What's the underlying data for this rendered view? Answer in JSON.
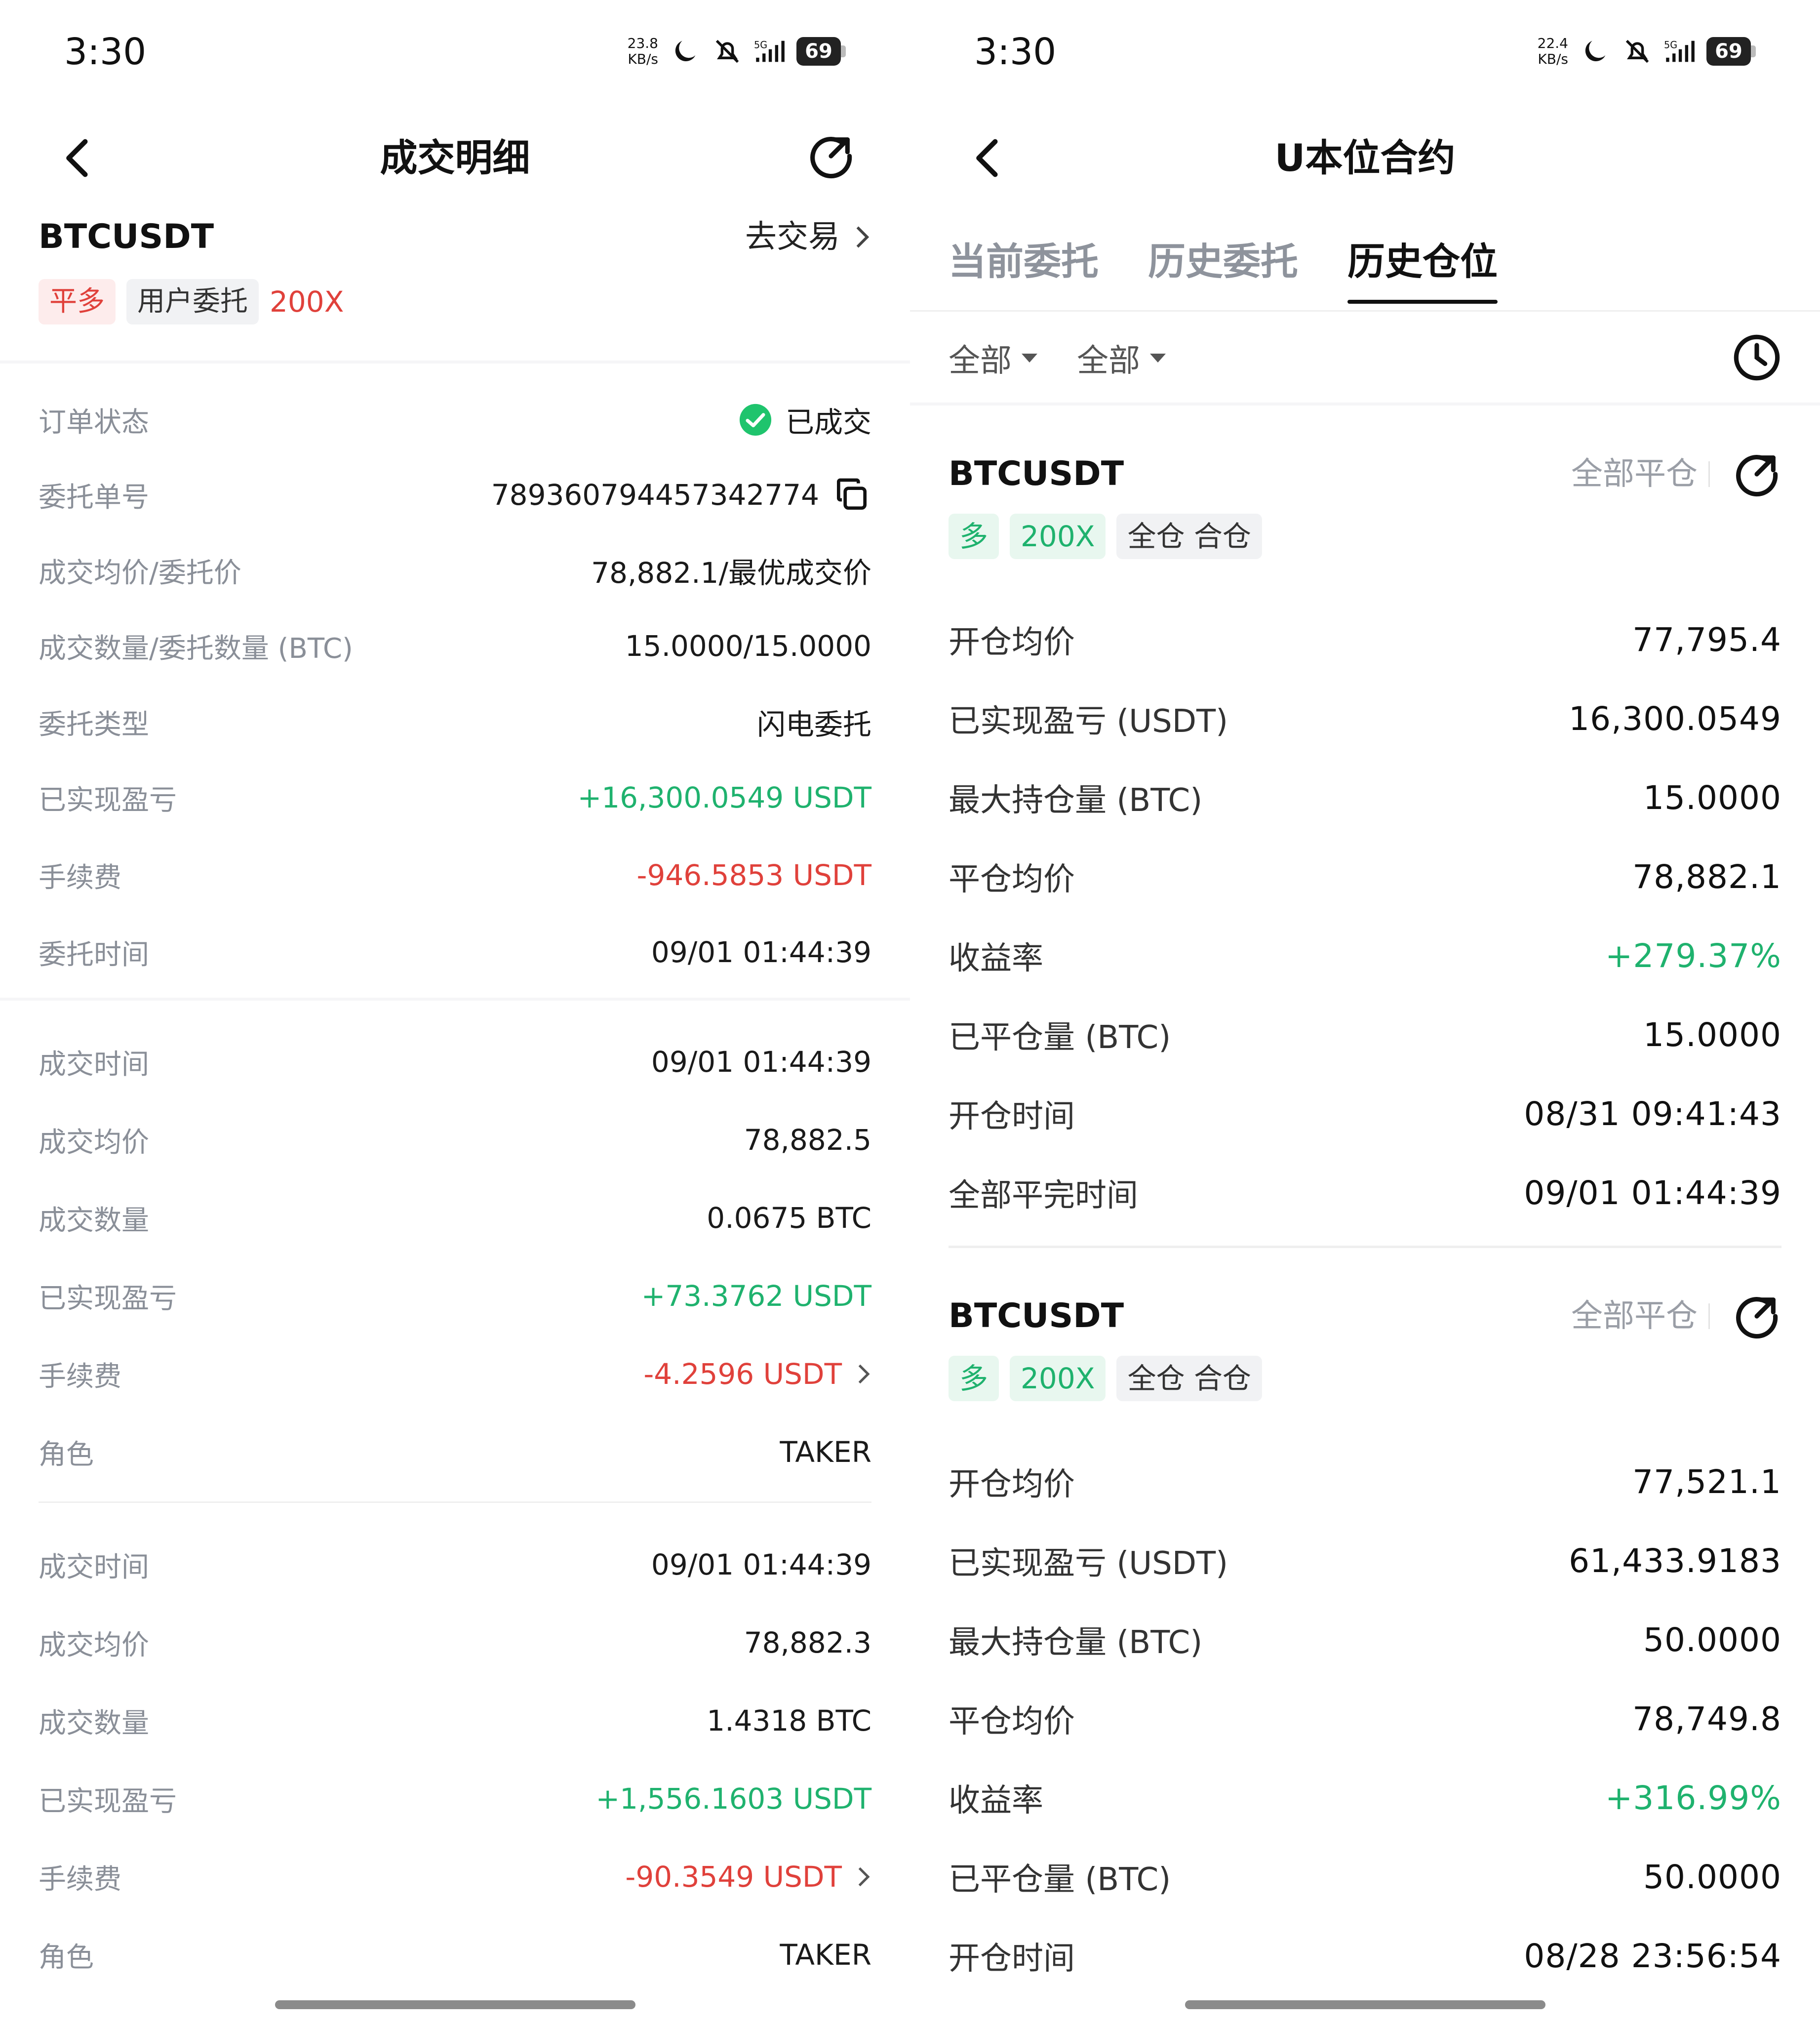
{
  "left": {
    "status": {
      "time": "3:30",
      "speed": "23.8",
      "speed_unit": "KB/s",
      "net": "5G",
      "battery": "69"
    },
    "title": "成交明细",
    "symbol": "BTCUSDT",
    "goto_trade": "去交易",
    "tags": {
      "side": "平多",
      "source": "用户委托",
      "leverage": "200X"
    },
    "details": [
      {
        "k": "订单状态",
        "v": "已成交"
      },
      {
        "k": "委托单号",
        "v": "789360794457342774"
      },
      {
        "k": "成交均价/委托价",
        "v": "78,882.1/最优成交价"
      },
      {
        "k": "成交数量/委托数量 (BTC)",
        "v": "15.0000/15.0000"
      },
      {
        "k": "委托类型",
        "v": "闪电委托"
      },
      {
        "k": "已实现盈亏",
        "v": "+16,300.0549 USDT"
      },
      {
        "k": "手续费",
        "v": "-946.5853 USDT"
      },
      {
        "k": "委托时间",
        "v": "09/01 01:44:39"
      }
    ],
    "fills": [
      [
        {
          "k": "成交时间",
          "v": "09/01 01:44:39"
        },
        {
          "k": "成交均价",
          "v": "78,882.5"
        },
        {
          "k": "成交数量",
          "v": "0.0675 BTC"
        },
        {
          "k": "已实现盈亏",
          "v": "+73.3762 USDT"
        },
        {
          "k": "手续费",
          "v": "-4.2596 USDT"
        },
        {
          "k": "角色",
          "v": "TAKER"
        }
      ],
      [
        {
          "k": "成交时间",
          "v": "09/01 01:44:39"
        },
        {
          "k": "成交均价",
          "v": "78,882.3"
        },
        {
          "k": "成交数量",
          "v": "1.4318 BTC"
        },
        {
          "k": "已实现盈亏",
          "v": "+1,556.1603 USDT"
        },
        {
          "k": "手续费",
          "v": "-90.3549 USDT"
        },
        {
          "k": "角色",
          "v": "TAKER"
        }
      ]
    ]
  },
  "right": {
    "status": {
      "time": "3:30",
      "speed": "22.4",
      "speed_unit": "KB/s",
      "net": "5G",
      "battery": "69"
    },
    "title": "U本位合约",
    "tabs": [
      "当前委托",
      "历史委托",
      "历史仓位"
    ],
    "filters": [
      "全部",
      "全部"
    ],
    "positions": [
      {
        "symbol": "BTCUSDT",
        "close_all": "全部平仓",
        "tags": {
          "side": "多",
          "leverage": "200X",
          "mode": "全仓 合仓"
        },
        "rows": [
          {
            "k": "开仓均价",
            "v": "77,795.4"
          },
          {
            "k": "已实现盈亏 (USDT)",
            "v": "16,300.0549"
          },
          {
            "k": "最大持仓量 (BTC)",
            "v": "15.0000"
          },
          {
            "k": "平仓均价",
            "v": "78,882.1"
          },
          {
            "k": "收益率",
            "v": "+279.37%"
          },
          {
            "k": "已平仓量 (BTC)",
            "v": "15.0000"
          },
          {
            "k": "开仓时间",
            "v": "08/31 09:41:43"
          },
          {
            "k": "全部平完时间",
            "v": "09/01 01:44:39"
          }
        ]
      },
      {
        "symbol": "BTCUSDT",
        "close_all": "全部平仓",
        "tags": {
          "side": "多",
          "leverage": "200X",
          "mode": "全仓 合仓"
        },
        "rows": [
          {
            "k": "开仓均价",
            "v": "77,521.1"
          },
          {
            "k": "已实现盈亏 (USDT)",
            "v": "61,433.9183"
          },
          {
            "k": "最大持仓量 (BTC)",
            "v": "50.0000"
          },
          {
            "k": "平仓均价",
            "v": "78,749.8"
          },
          {
            "k": "收益率",
            "v": "+316.99%"
          },
          {
            "k": "已平仓量 (BTC)",
            "v": "50.0000"
          },
          {
            "k": "开仓时间",
            "v": "08/28 23:56:54"
          }
        ]
      }
    ]
  },
  "colors": {
    "profit": "#1fb26e",
    "loss": "#e0413b",
    "label": "#8a8f98"
  }
}
